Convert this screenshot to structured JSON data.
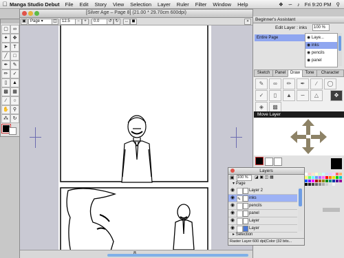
{
  "menubar": {
    "apple": "",
    "app_name": "Manga Studio Debut",
    "items": [
      "File",
      "Edit",
      "Story",
      "View",
      "Selection",
      "Layer",
      "Ruler",
      "Filter",
      "Window",
      "Help"
    ],
    "clock": "Fri 9:20 PM"
  },
  "window": {
    "title": "[Silver Age – Page 8] (21.00 * 29.70cm 600dpi)",
    "page_dropdown": "Page",
    "zoom": "12.5",
    "angle": "0.0",
    "page_number": "8"
  },
  "assistant": {
    "title": "Beginner's Assistant",
    "edit_layer_label": "Edit Layer : inks",
    "zoom": "100 %",
    "entire_page": "Entire Page",
    "mini_layers": [
      "Laye...",
      "inks",
      "pencils",
      "panel"
    ]
  },
  "tool_tabs": [
    "Sketch",
    "Panel",
    "Draw",
    "Tone",
    "Character"
  ],
  "active_tab": "Draw",
  "move_layer_label": "Move Layer",
  "layers_palette": {
    "title": "Layers",
    "zoom": "100 %",
    "group": "Page",
    "rows": [
      {
        "name": "Layer 2",
        "selected": false
      },
      {
        "name": "inks",
        "selected": true
      },
      {
        "name": "pencils",
        "selected": false
      },
      {
        "name": "panel",
        "selected": false
      },
      {
        "name": "Layer",
        "selected": false
      },
      {
        "name": "Layer",
        "selected": false
      }
    ],
    "selection_label": "Selection",
    "status": "Raster Layer 600 dpi(Color (32 bits..."
  },
  "colors": {
    "accent": "#8fa6f0",
    "selected_row": "#9db2f5",
    "menubar": "#e8e8e8"
  }
}
